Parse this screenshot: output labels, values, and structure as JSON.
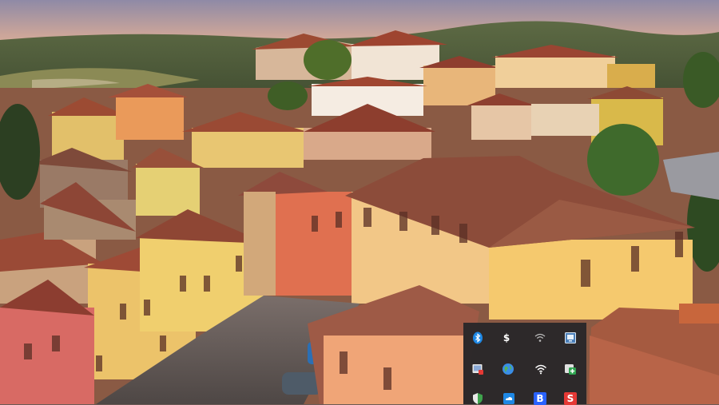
{
  "desktop": {
    "wallpaper": "hilltop-town-at-sunset"
  },
  "tray_overflow": {
    "icons": [
      {
        "name": "bluetooth-icon",
        "color": "#1e88e5"
      },
      {
        "name": "dollar-app-icon",
        "glyph": "$",
        "color": "#ffffff"
      },
      {
        "name": "wifi-icon",
        "color": "#cfcfcf"
      },
      {
        "name": "monitor-app-icon",
        "color": "#4b7fb8"
      },
      {
        "name": "image-viewer-icon",
        "color": "#d9d9d9"
      },
      {
        "name": "globe-icon",
        "color": "#3a8ee6"
      },
      {
        "name": "wifi-signal-icon",
        "color": "#ffffff"
      },
      {
        "name": "green-app-icon",
        "color": "#2ea44f"
      },
      {
        "name": "shield-icon",
        "color": "#3fa34d"
      },
      {
        "name": "blue-cloud-icon",
        "color": "#1e88e5"
      },
      {
        "name": "b-app-icon",
        "glyph": "B",
        "color": "#2962ff"
      },
      {
        "name": "s-app-icon",
        "glyph": "S",
        "color": "#e53935"
      }
    ]
  }
}
